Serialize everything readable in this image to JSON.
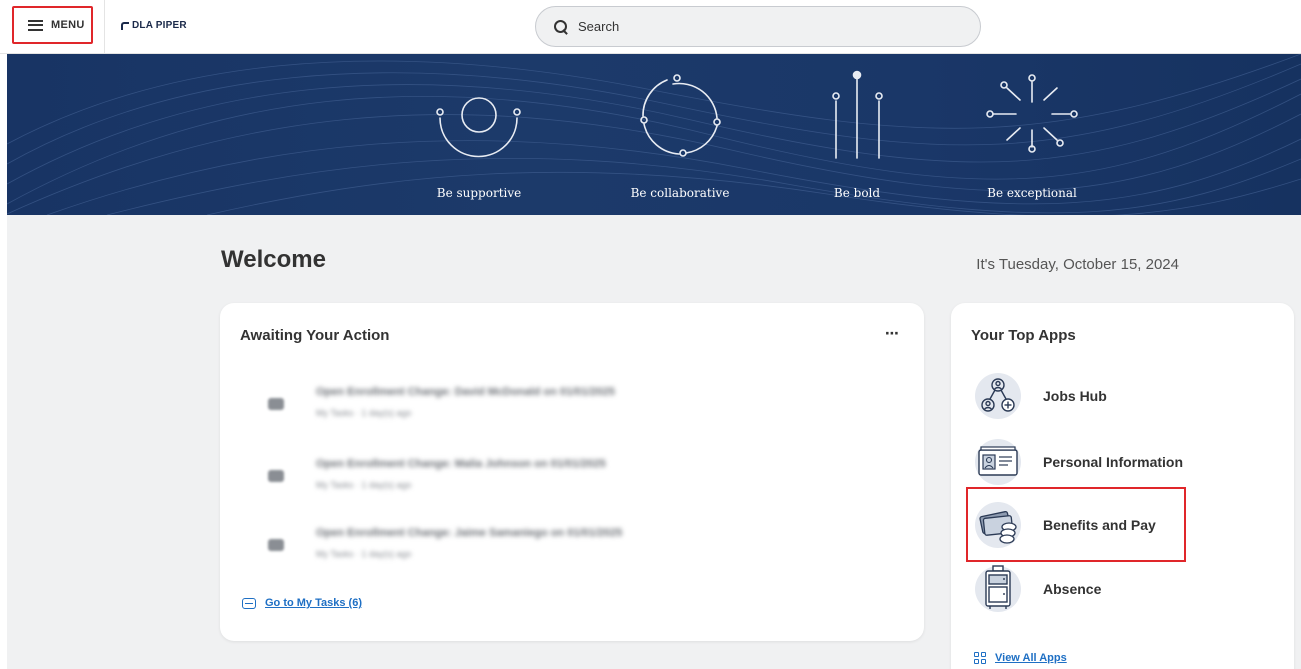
{
  "header": {
    "menu_label": "MENU",
    "logo_text": "DLA PIPER",
    "search_placeholder": "Search"
  },
  "banner": {
    "values": [
      {
        "label": "Be supportive",
        "icon": "open-circle-icon"
      },
      {
        "label": "Be collaborative",
        "icon": "connected-circle-icon"
      },
      {
        "label": "Be bold",
        "icon": "vertical-bars-icon"
      },
      {
        "label": "Be exceptional",
        "icon": "burst-icon"
      }
    ]
  },
  "main": {
    "welcome": "Welcome",
    "date": "It's Tuesday, October 15, 2024"
  },
  "awaiting": {
    "title": "Awaiting Your Action",
    "more_label": "⋯",
    "tasks": [
      {
        "title": "Open Enrollment Change: David McDonald on 01/01/2025",
        "subtitle": "My Tasks · 1 day(s) ago"
      },
      {
        "title": "Open Enrollment Change: Malia Johnson on 01/01/2025",
        "subtitle": "My Tasks · 1 day(s) ago"
      },
      {
        "title": "Open Enrollment Change: Jaime Samaniego on 01/01/2025",
        "subtitle": "My Tasks · 1 day(s) ago"
      }
    ],
    "go_to_tasks": "Go to My Tasks (6)"
  },
  "top_apps": {
    "title": "Your Top Apps",
    "apps": [
      {
        "label": "Jobs Hub",
        "icon": "jobs-hub-icon"
      },
      {
        "label": "Personal Information",
        "icon": "id-card-icon"
      },
      {
        "label": "Benefits and Pay",
        "icon": "money-icon"
      },
      {
        "label": "Absence",
        "icon": "suitcase-icon"
      }
    ],
    "view_all": "View All Apps"
  },
  "colors": {
    "banner": "#1a3768",
    "accent_link": "#1e6fc4",
    "highlight": "#e0262a",
    "background": "#f0f1f2"
  }
}
